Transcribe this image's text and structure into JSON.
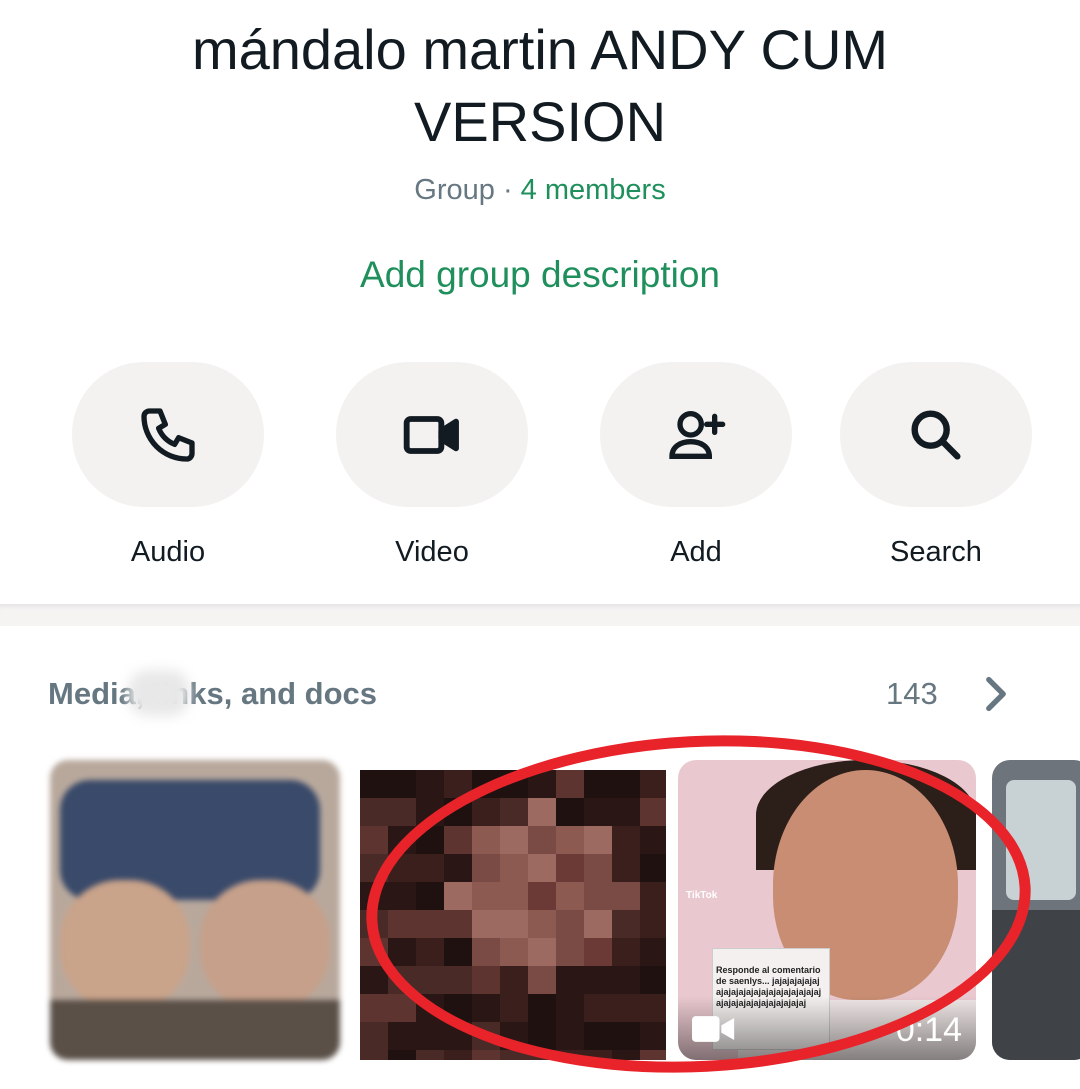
{
  "header": {
    "title": "mándalo martin ANDY CUM VERSION",
    "subtitle_type": "Group",
    "subtitle_sep": " · ",
    "subtitle_members": "4 members",
    "add_description": "Add group description"
  },
  "actions": [
    {
      "label": "Audio",
      "icon": "phone-icon"
    },
    {
      "label": "Video",
      "icon": "video-camera-icon"
    },
    {
      "label": "Add",
      "icon": "add-person-icon"
    },
    {
      "label": "Search",
      "icon": "search-icon"
    }
  ],
  "media": {
    "title": "Media, links, and docs",
    "count": "143",
    "thumbs": [
      {
        "kind": "video",
        "duration": "0:14"
      }
    ],
    "tiktok_label": "TikTok",
    "card_text": "Responde al comentario de saenlys... jajajajajajajajajajajajajajajajajajajajajajajajajajajajajajajajaj"
  },
  "colors": {
    "accent_green": "#1f8f5c",
    "annotation_red": "#e8232a"
  }
}
